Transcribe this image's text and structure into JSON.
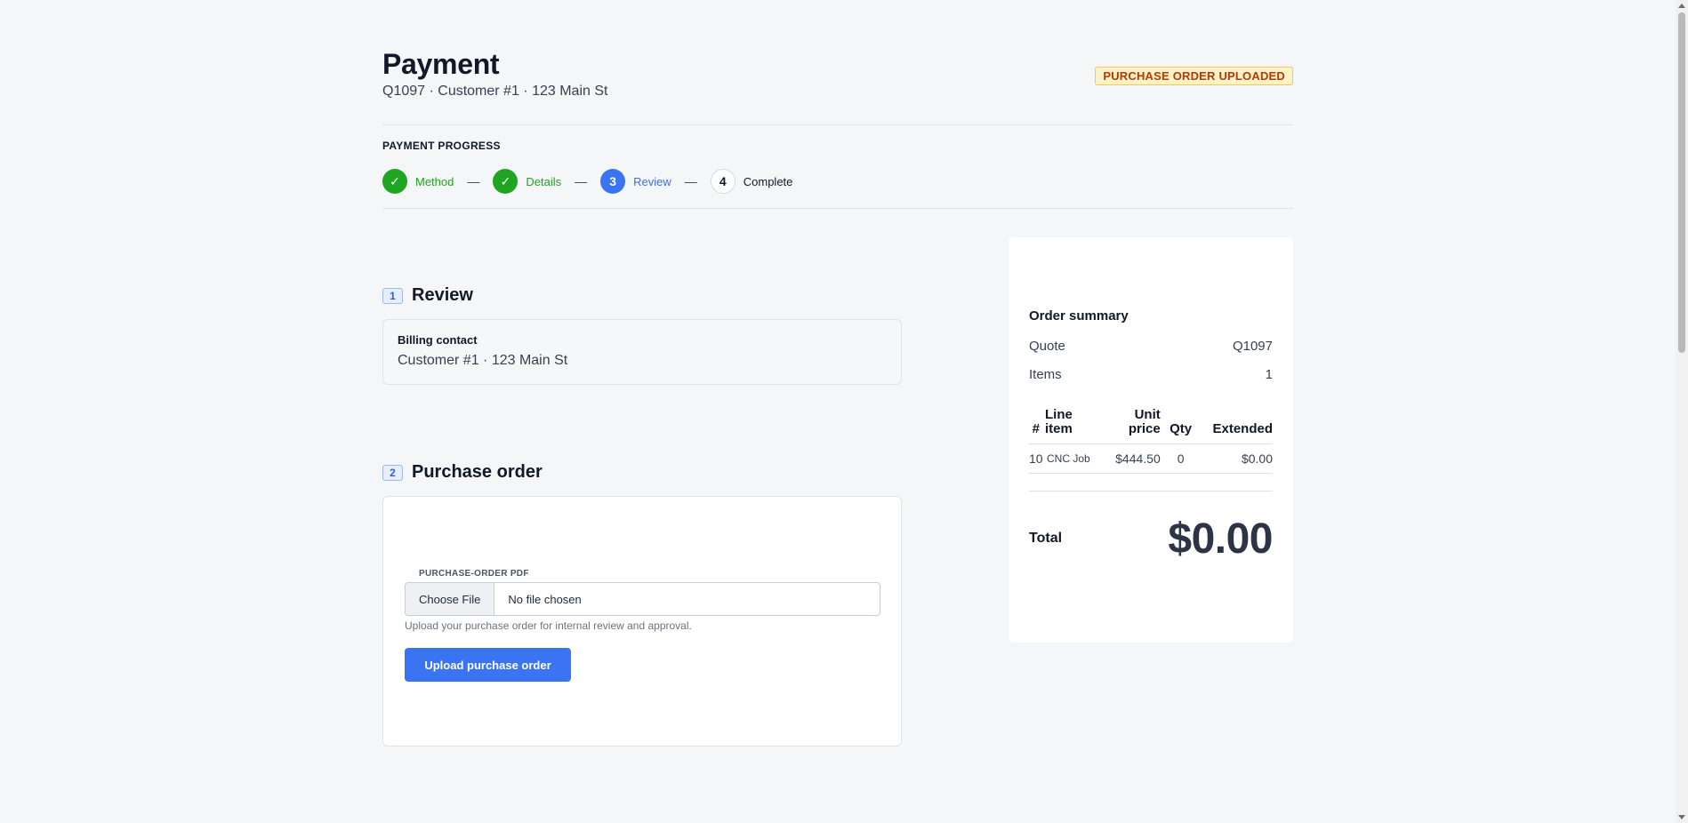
{
  "header": {
    "title": "Payment",
    "subtitle": "Q1097 · Customer #1 · 123 Main St",
    "status_badge": "PURCHASE ORDER UPLOADED"
  },
  "progress": {
    "label": "PAYMENT PROGRESS",
    "separator": "—",
    "steps": [
      {
        "marker": "✓",
        "label": "Method",
        "state": "done"
      },
      {
        "marker": "✓",
        "label": "Details",
        "state": "done"
      },
      {
        "marker": "3",
        "label": "Review",
        "state": "active"
      },
      {
        "marker": "4",
        "label": "Complete",
        "state": "pending"
      }
    ]
  },
  "review": {
    "number": "1",
    "title": "Review",
    "billing_label": "Billing contact",
    "billing_value": "Customer #1 · 123 Main St"
  },
  "purchase_order": {
    "number": "2",
    "title": "Purchase order",
    "file_label": "PURCHASE-ORDER PDF",
    "choose_button": "Choose File",
    "file_status": "No file chosen",
    "help_text": "Upload your purchase order for internal review and approval.",
    "upload_button": "Upload purchase order"
  },
  "summary": {
    "title": "Order summary",
    "quote_label": "Quote",
    "quote_value": "Q1097",
    "items_label": "Items",
    "items_value": "1",
    "columns": {
      "num": "#",
      "line_item_1": "Line",
      "line_item_2": "item",
      "unit_price_1": "Unit",
      "unit_price_2": "price",
      "qty": "Qty",
      "extended": "Extended"
    },
    "rows": [
      {
        "num": "10",
        "item": "CNC Job",
        "unit_price": "$444.50",
        "qty": "0",
        "extended": "$0.00"
      }
    ],
    "total_label": "Total",
    "total_value": "$0.00"
  },
  "colors": {
    "accent": "#3b74f2",
    "success": "#1fa51f",
    "badge_bg": "#fef3c7",
    "badge_text": "#b4390a"
  }
}
